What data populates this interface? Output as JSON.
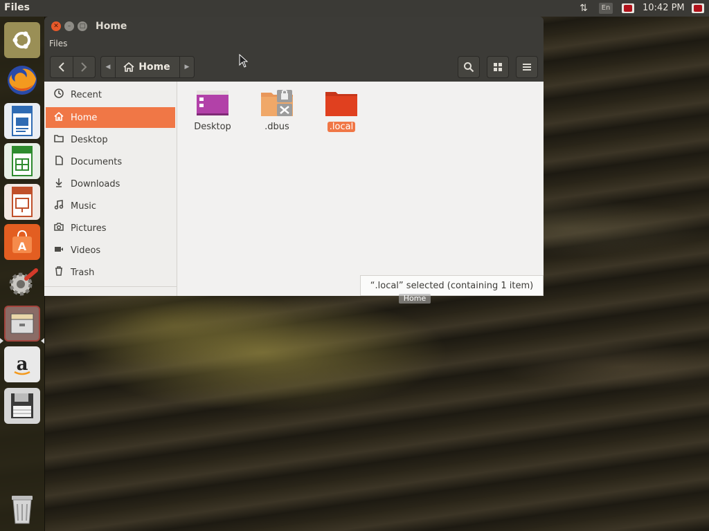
{
  "top_panel": {
    "app_title": "Files",
    "network_icon": "network-updown-icon",
    "lang": "En",
    "clock": "10:42 PM"
  },
  "launcher": {
    "items": [
      {
        "name": "Search your computer",
        "icon": "ubuntu-dash-icon"
      },
      {
        "name": "Firefox Web Browser",
        "icon": "firefox-icon"
      },
      {
        "name": "LibreOffice Writer",
        "icon": "writer-icon"
      },
      {
        "name": "LibreOffice Calc",
        "icon": "calc-icon"
      },
      {
        "name": "LibreOffice Impress",
        "icon": "impress-icon"
      },
      {
        "name": "Ubuntu Software",
        "icon": "software-center-icon"
      },
      {
        "name": "System Settings",
        "icon": "settings-icon"
      },
      {
        "name": "Files",
        "icon": "files-icon",
        "active": true
      },
      {
        "name": "Amazon",
        "icon": "amazon-icon"
      },
      {
        "name": "Save",
        "icon": "floppy-icon"
      },
      {
        "name": "Trash",
        "icon": "trash-icon"
      }
    ]
  },
  "window": {
    "title": "Home",
    "menu": "Files",
    "toolbar": {
      "back": "back-icon",
      "forward": "forward-icon",
      "path_label": "Home",
      "search": "search-icon",
      "view": "grid-view-icon",
      "menu": "hamburger-menu-icon"
    },
    "sidebar": {
      "items": [
        {
          "label": "Recent",
          "icon": "clock-icon"
        },
        {
          "label": "Home",
          "icon": "home-icon",
          "active": true
        },
        {
          "label": "Desktop",
          "icon": "folder-icon"
        },
        {
          "label": "Documents",
          "icon": "document-icon"
        },
        {
          "label": "Downloads",
          "icon": "download-icon"
        },
        {
          "label": "Music",
          "icon": "music-icon"
        },
        {
          "label": "Pictures",
          "icon": "camera-icon"
        },
        {
          "label": "Videos",
          "icon": "video-icon"
        },
        {
          "label": "Trash",
          "icon": "trash-icon"
        }
      ]
    },
    "files": [
      {
        "label": "Desktop",
        "icon": "desktop-folder-icon",
        "selected": false
      },
      {
        "label": ".dbus",
        "icon": "locked-folder-icon",
        "selected": false
      },
      {
        "label": ".local",
        "icon": "folder-icon",
        "selected": true
      }
    ],
    "status": "“.local” selected (containing 1 item)",
    "tooltip": "Home"
  },
  "colors": {
    "accent": "#f07746",
    "panel": "#3c3b37",
    "folder": "#e0401f"
  }
}
